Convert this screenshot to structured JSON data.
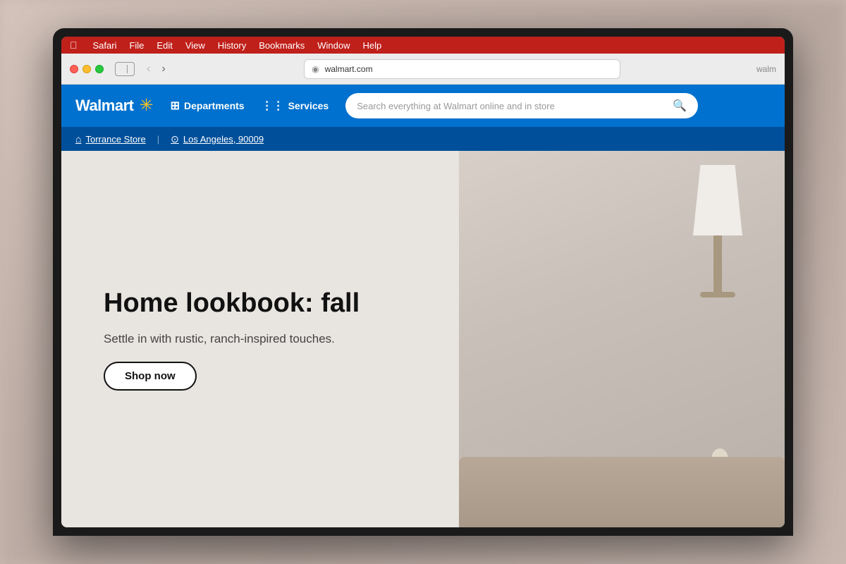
{
  "background": {
    "color": "#c8b8b0"
  },
  "macos_menubar": {
    "apple_symbol": "",
    "items": [
      "Safari",
      "File",
      "Edit",
      "View",
      "History",
      "Bookmarks",
      "Window",
      "Help"
    ]
  },
  "browser_chrome": {
    "address": "walmart.com",
    "address_display": "walmart.com",
    "reader_icon": "⊕",
    "site_label": "walm"
  },
  "walmart": {
    "logo_text": "Walmart",
    "spark_symbol": "✳",
    "nav": {
      "departments_label": "Departments",
      "services_label": "Services"
    },
    "search": {
      "placeholder": "Search everything at Walmart online and in store"
    },
    "store_bar": {
      "store_icon": "⌂",
      "store_name": "Torrance Store",
      "divider": "|",
      "location_icon": "⊙",
      "location": "Los Angeles, 90009"
    },
    "hero": {
      "title": "Home lookbook: fall",
      "subtitle": "Settle in with rustic, ranch-inspired touches.",
      "cta_label": "Shop now"
    }
  }
}
